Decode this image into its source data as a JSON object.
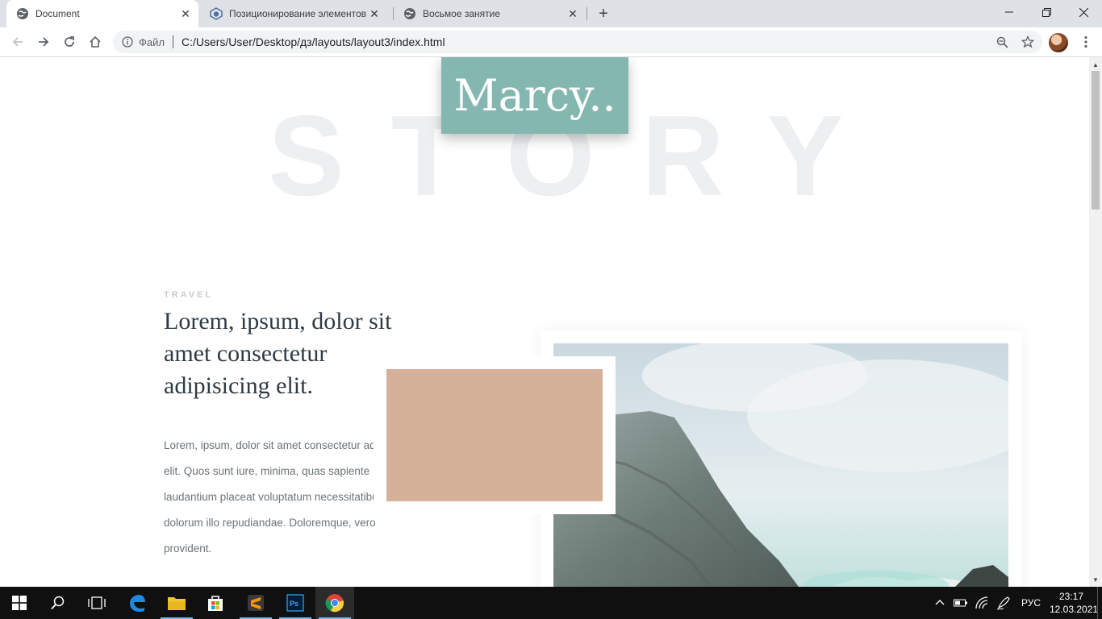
{
  "browser": {
    "tabs": [
      {
        "label": "Document",
        "active": true
      },
      {
        "label": "Позиционирование элементов",
        "active": false
      },
      {
        "label": "Восьмое занятие",
        "active": false
      }
    ],
    "address": {
      "scheme_label": "Файл",
      "url": "C:/Users/User/Desktop/дз/layouts/layout3/index.html"
    }
  },
  "page": {
    "logo": "Marcy..",
    "watermark": "STORY",
    "kicker": "TRAVEL",
    "heading": "Lorem, ipsum, dolor sit amet consectetur adipisicing elit.",
    "body": "Lorem, ipsum, dolor sit amet consectetur adipisicing elit. Quos sunt iure, minima, quas sapiente laudantium placeat voluptatum necessitatibus modi, dolorum illo repudiandae. Doloremque, vero provident.",
    "colors": {
      "logo_bg": "#84b7b0",
      "swatch": "#d5b19a"
    }
  },
  "taskbar": {
    "language": "РУС",
    "time": "23:17",
    "date": "12.03.2021"
  }
}
